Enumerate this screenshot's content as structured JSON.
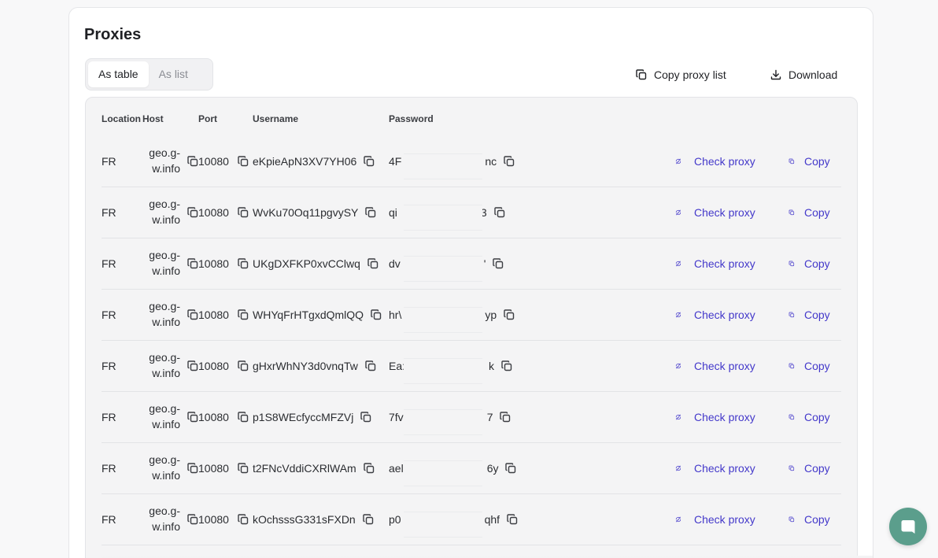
{
  "card": {
    "title": "Proxies"
  },
  "tabs": [
    {
      "label": "As table",
      "active": true
    },
    {
      "label": "As list",
      "active": false
    }
  ],
  "toolbar": {
    "copy_list_label": "Copy proxy list",
    "download_label": "Download"
  },
  "table": {
    "headers": {
      "location": "Location",
      "host": "Host",
      "port": "Port",
      "username": "Username",
      "password": "Password"
    },
    "rows": [
      {
        "location": "FR",
        "host_line1": "geo.g-",
        "host_line2": "w.info",
        "port": "10080",
        "username": "eKpieApN3XV7YH06",
        "pass_start": "4F",
        "pass_end": "nc",
        "check_label": "Check proxy",
        "copy_label": "Copy"
      },
      {
        "location": "FR",
        "host_line1": "geo.g-",
        "host_line2": "w.info",
        "port": "10080",
        "username": "WvKu70Oq11pgvySY",
        "pass_start": "qi",
        "pass_end": "3",
        "check_label": "Check proxy",
        "copy_label": "Copy"
      },
      {
        "location": "FR",
        "host_line1": "geo.g-",
        "host_line2": "w.info",
        "port": "10080",
        "username": "UKgDXFKP0xvCClwq",
        "pass_start": "dv",
        "pass_end": "'",
        "check_label": "Check proxy",
        "copy_label": "Copy"
      },
      {
        "location": "FR",
        "host_line1": "geo.g-",
        "host_line2": "w.info",
        "port": "10080",
        "username": "WHYqFrHTgxdQmlQQ",
        "pass_start": "hr\\",
        "pass_end": "yp",
        "check_label": "Check proxy",
        "copy_label": "Copy"
      },
      {
        "location": "FR",
        "host_line1": "geo.g-",
        "host_line2": "w.info",
        "port": "10080",
        "username": "gHxrWhNY3d0vnqTw",
        "pass_start": "Ea:",
        "pass_end": "k",
        "check_label": "Check proxy",
        "copy_label": "Copy"
      },
      {
        "location": "FR",
        "host_line1": "geo.g-",
        "host_line2": "w.info",
        "port": "10080",
        "username": "p1S8WEcfyccMFZVj",
        "pass_start": "7fv",
        "pass_end": "7",
        "check_label": "Check proxy",
        "copy_label": "Copy"
      },
      {
        "location": "FR",
        "host_line1": "geo.g-",
        "host_line2": "w.info",
        "port": "10080",
        "username": "t2FNcVddiCXRlWAm",
        "pass_start": "ael",
        "pass_end": "6y",
        "check_label": "Check proxy",
        "copy_label": "Copy"
      },
      {
        "location": "FR",
        "host_line1": "geo.g-",
        "host_line2": "w.info",
        "port": "10080",
        "username": "kOchsssG331sFXDn",
        "pass_start": "p0",
        "pass_end": "qhf",
        "check_label": "Check proxy",
        "copy_label": "Copy"
      }
    ]
  },
  "icons": {
    "copy": "copy-icon",
    "download": "download-icon",
    "check": "refresh-check-icon",
    "chat": "chat-bubble-icon"
  },
  "colors": {
    "link": "#4338ca",
    "chat_button": "#5b9e8c"
  }
}
